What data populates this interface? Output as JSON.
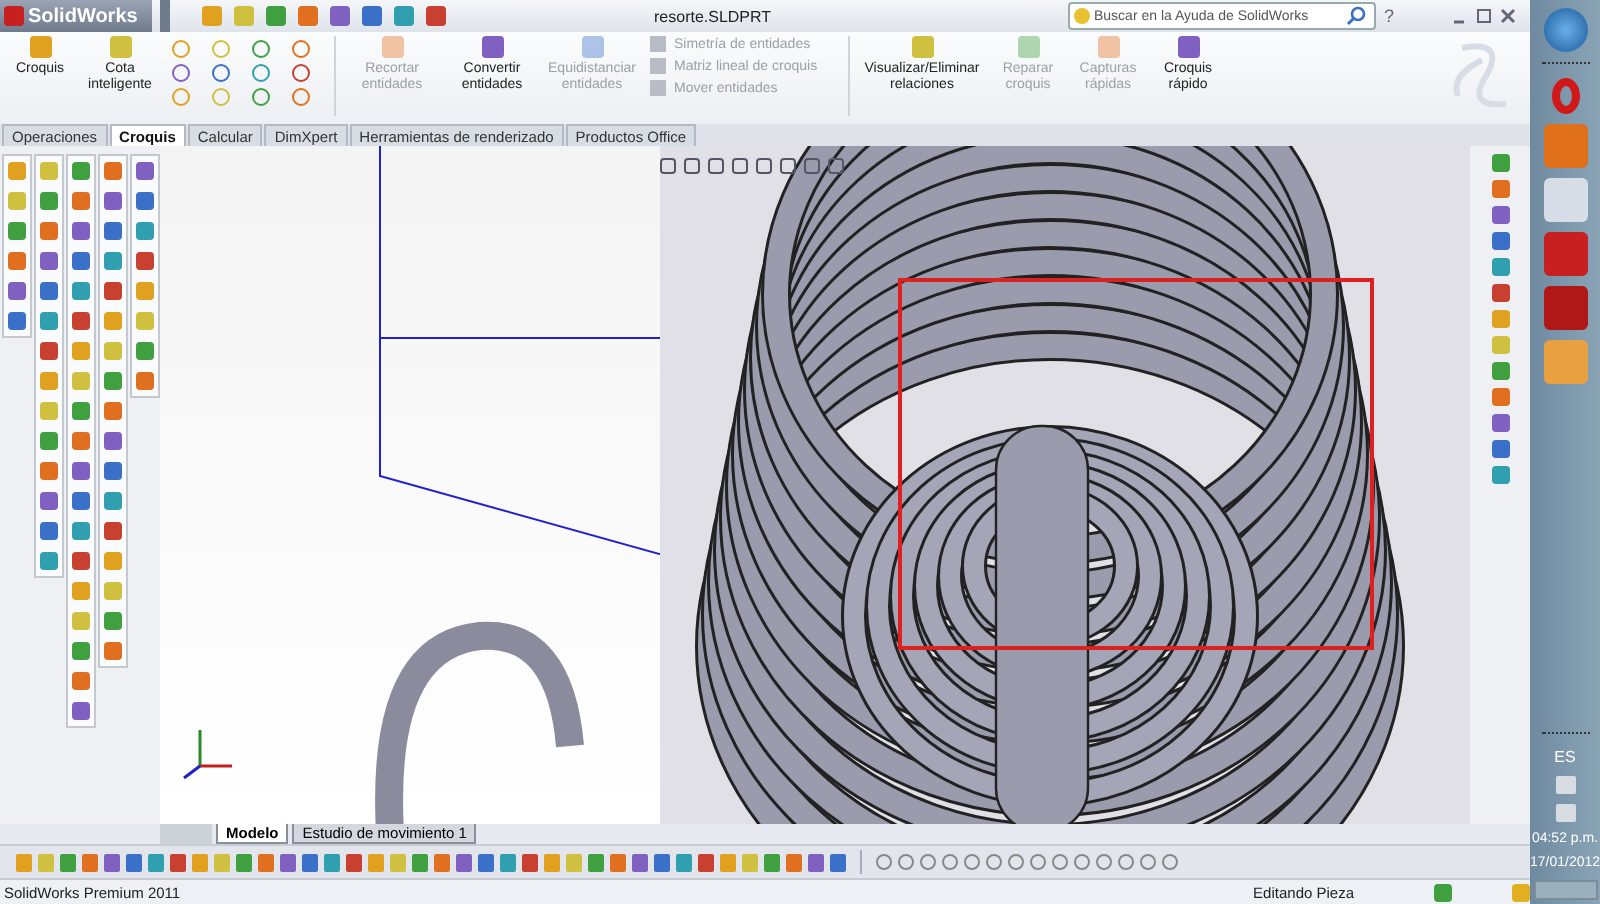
{
  "title_bar": {
    "logo": "SolidWorks",
    "title": "resorte.SLDPRT",
    "help": "?",
    "search": {
      "placeholder": "Buscar en la Ayuda de SolidWorks"
    }
  },
  "ribbon": {
    "left": [
      {
        "label": "Croquis",
        "disabled": false
      },
      {
        "label": "Cota inteligente",
        "disabled": false
      }
    ],
    "edit": [
      {
        "label": "Recortar entidades",
        "disabled": true
      },
      {
        "label": "Convertir entidades",
        "disabled": false
      },
      {
        "label": "Equidistanciar entidades",
        "disabled": true
      }
    ],
    "stacked": [
      {
        "label": "Simetría de entidades",
        "disabled": true
      },
      {
        "label": "Matriz lineal de croquis",
        "disabled": true
      },
      {
        "label": "Mover entidades",
        "disabled": true
      }
    ],
    "right": [
      {
        "label": "Visualizar/Eliminar relaciones",
        "disabled": false
      },
      {
        "label": "Reparar croquis",
        "disabled": true
      },
      {
        "label": "Capturas rápidas",
        "disabled": true
      },
      {
        "label": "Croquis rápido",
        "disabled": false
      }
    ]
  },
  "tabs": [
    {
      "label": "Operaciones",
      "selected": false
    },
    {
      "label": "Croquis",
      "selected": true
    },
    {
      "label": "Calcular",
      "selected": false
    },
    {
      "label": "DimXpert",
      "selected": false
    },
    {
      "label": "Herramientas de renderizado",
      "selected": false
    },
    {
      "label": "Productos Office",
      "selected": false
    }
  ],
  "bottom_tabs": [
    {
      "label": "Modelo",
      "selected": true
    },
    {
      "label": "Estudio de movimiento 1",
      "selected": false
    }
  ],
  "status_bar": {
    "product": "SolidWorks Premium 2011",
    "mode": "Editando Pieza"
  },
  "taskbar": {
    "language": "ES",
    "time": "04:52 p.m.",
    "date": "17/01/2012"
  }
}
